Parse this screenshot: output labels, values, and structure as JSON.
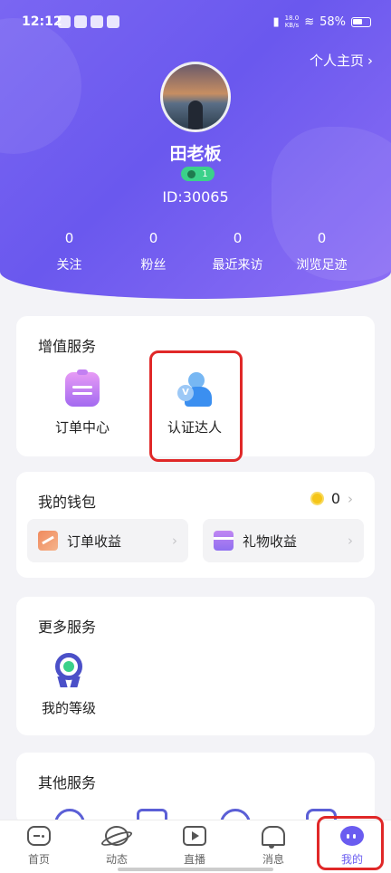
{
  "status_bar": {
    "time": "12:12",
    "net_speed_value": "18.0",
    "net_speed_unit": "KB/s",
    "battery": "58%"
  },
  "profile": {
    "homepage_link": "个人主页",
    "username": "田老板",
    "level": "1",
    "user_id": "ID:30065"
  },
  "stats": [
    {
      "value": "0",
      "label": "关注"
    },
    {
      "value": "0",
      "label": "粉丝"
    },
    {
      "value": "0",
      "label": "最近来访"
    },
    {
      "value": "0",
      "label": "浏览足迹"
    }
  ],
  "value_services": {
    "title": "增值服务",
    "items": [
      {
        "label": "订单中心",
        "icon": "clipboard-icon"
      },
      {
        "label": "认证达人",
        "icon": "verified-user-icon"
      }
    ]
  },
  "wallet": {
    "title": "我的钱包",
    "balance": "0",
    "buttons": [
      {
        "label": "订单收益",
        "icon": "order-income-icon"
      },
      {
        "label": "礼物收益",
        "icon": "gift-income-icon"
      }
    ]
  },
  "more_services": {
    "title": "更多服务",
    "items": [
      {
        "label": "我的等级",
        "icon": "medal-icon"
      }
    ]
  },
  "other_services": {
    "title": "其他服务"
  },
  "bottom_nav": [
    {
      "label": "首页",
      "icon": "gamepad-icon"
    },
    {
      "label": "动态",
      "icon": "planet-icon"
    },
    {
      "label": "直播",
      "icon": "tv-play-icon"
    },
    {
      "label": "消息",
      "icon": "bell-icon"
    },
    {
      "label": "我的",
      "icon": "profile-face-icon",
      "active": true
    }
  ],
  "colors": {
    "accent": "#6a5cf0",
    "highlight": "#e02828",
    "header_gradient_start": "#7a66f2",
    "header_gradient_end": "#8d6ff5"
  }
}
